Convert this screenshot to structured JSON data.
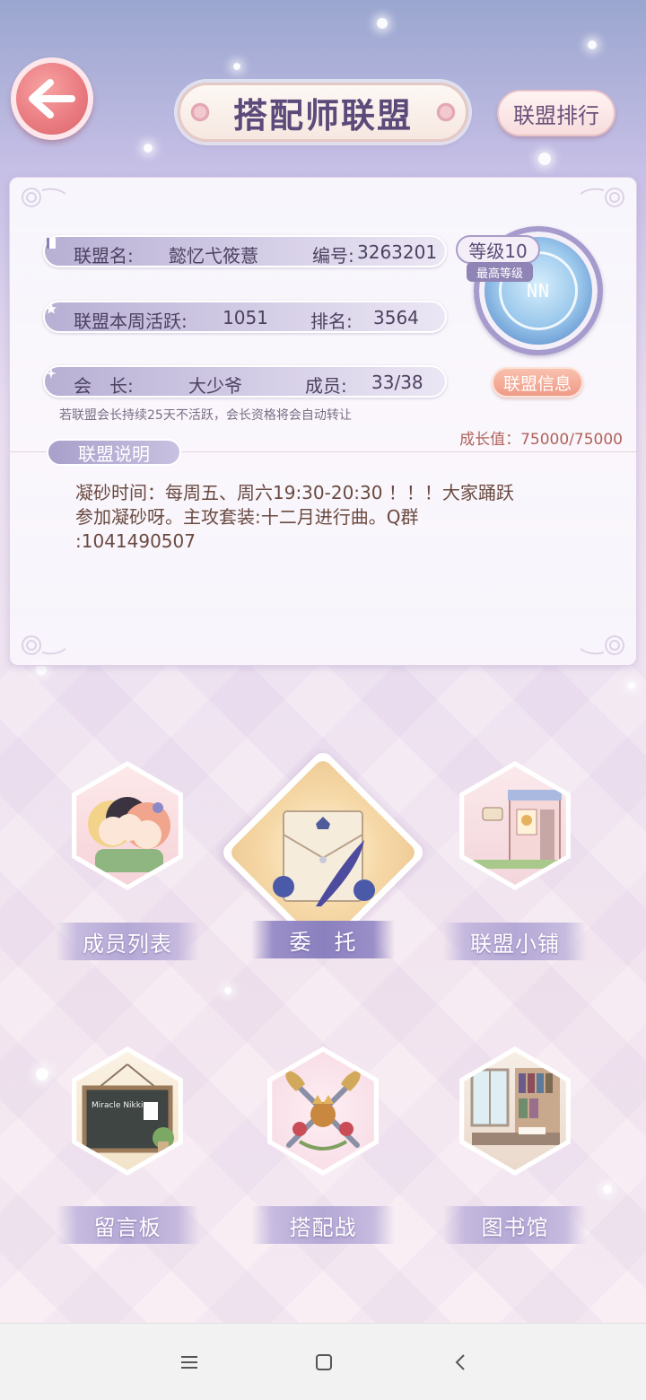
{
  "header": {
    "title": "搭配师联盟",
    "rank_button": "联盟排行"
  },
  "alliance": {
    "name_label": "联盟名:",
    "name": "懿忆弋筱薏",
    "id_label": "编号:",
    "id": "3263201",
    "activity_label": "联盟本周活跃:",
    "activity": "1051",
    "rank_label": "排名:",
    "rank": "3564",
    "leader_label": "会　长:",
    "leader": "大少爷",
    "members_label": "成员:",
    "members": "33/38",
    "level": "等级10",
    "level_sub": "最高等级",
    "emblem_text": "NN",
    "info_button": "联盟信息",
    "notice": "若联盟会长持续25天不活跃，会长资格将会自动转让",
    "growth": "成长值：75000/75000",
    "desc_tag": "联盟说明",
    "description": "凝砂时间：每周五、周六19:30-20:30 ！！！大家踊跃\n参加凝砂呀。主攻套装:十二月进行曲。Q群\n:1041490507"
  },
  "features": [
    {
      "label": "成员列表",
      "icon": "members-icon"
    },
    {
      "label": "委　托",
      "icon": "envelope-quill-icon"
    },
    {
      "label": "联盟小铺",
      "icon": "shop-icon"
    },
    {
      "label": "留言板",
      "icon": "message-board-icon"
    },
    {
      "label": "搭配战",
      "icon": "crossed-swords-icon"
    },
    {
      "label": "图书馆",
      "icon": "library-icon"
    }
  ],
  "board_text": "Miracle Nikki",
  "navbar": {
    "menu_icon": "menu-icon",
    "home_icon": "home-icon",
    "back_icon": "back-icon"
  }
}
